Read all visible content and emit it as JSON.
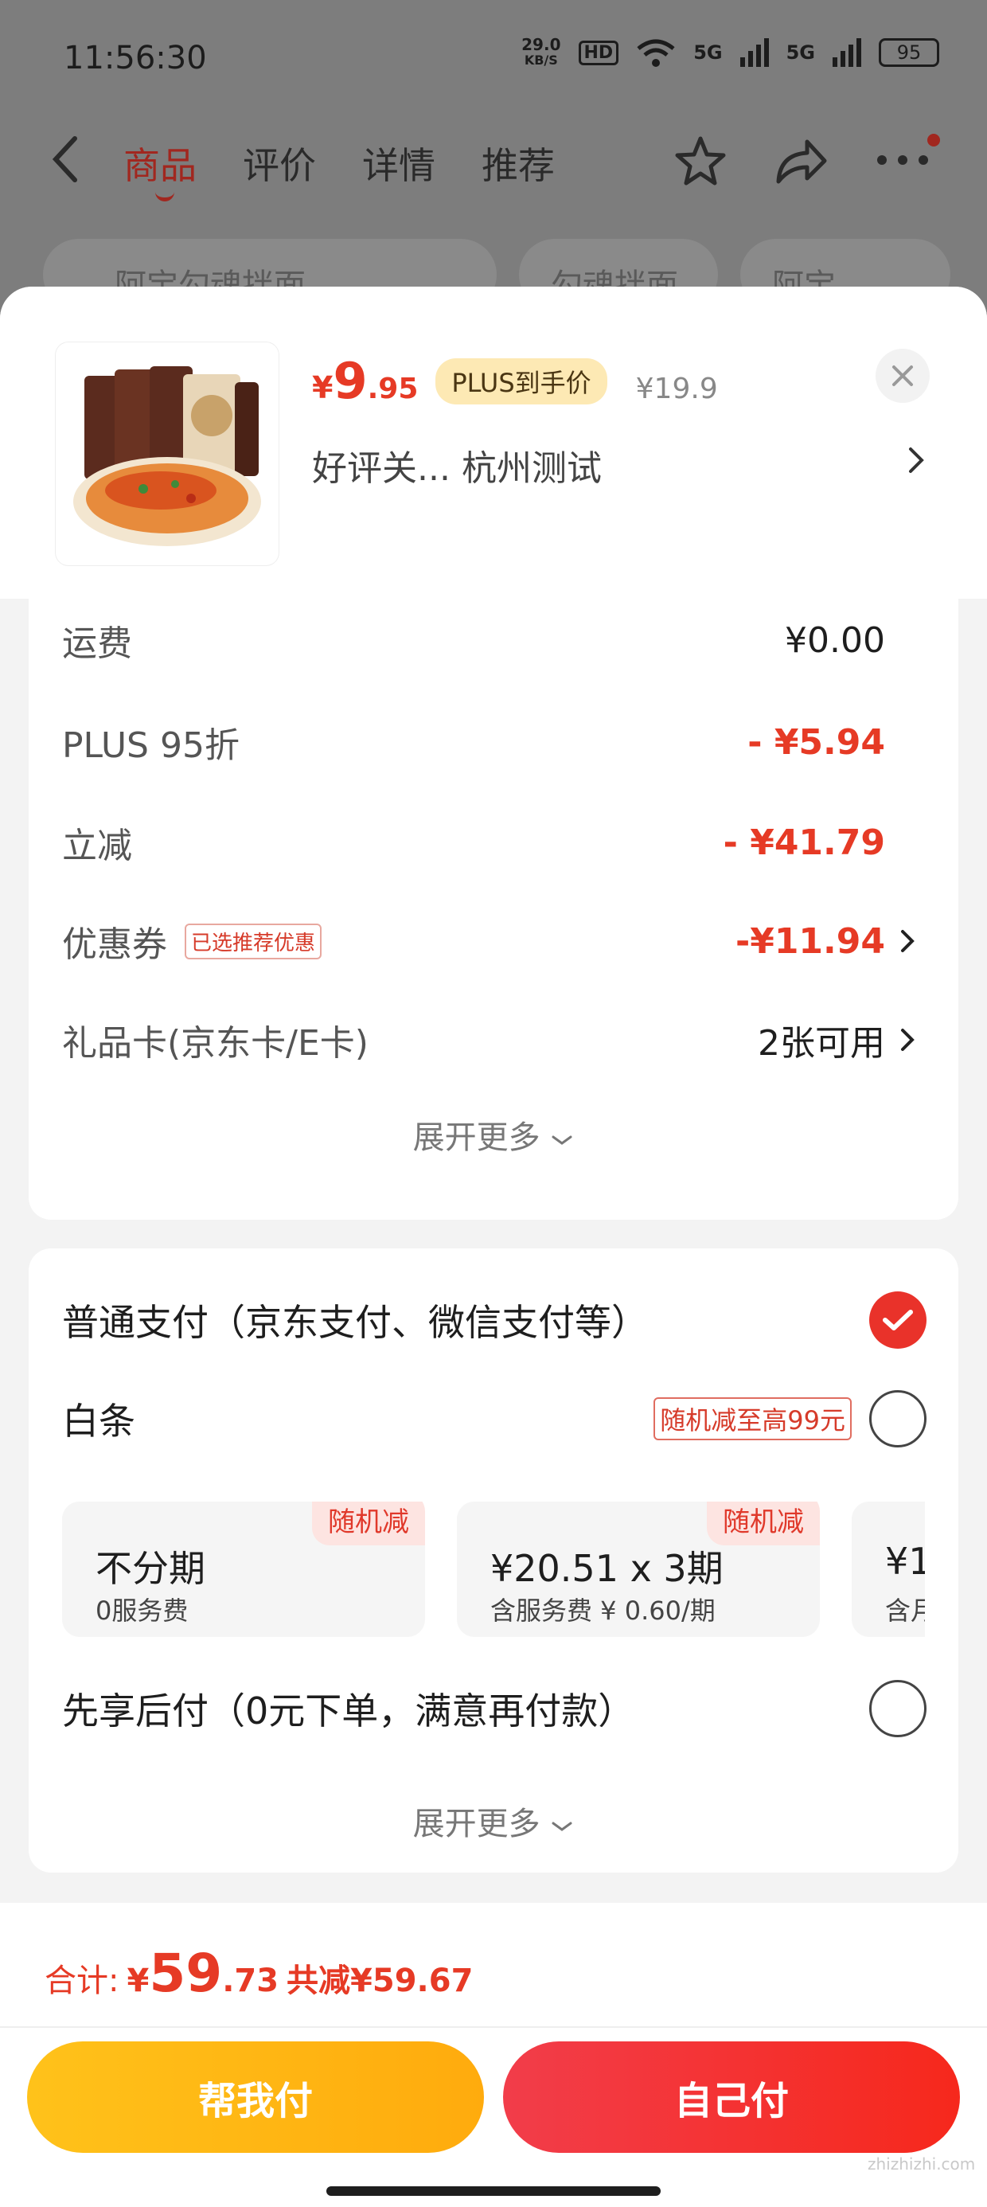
{
  "status_bar": {
    "time": "11:56:30",
    "speed_value": "29.0",
    "speed_unit": "KB/S",
    "hd": "HD",
    "sig1": "5G",
    "sig2": "5G",
    "battery": "95"
  },
  "nav": {
    "tabs": [
      "商品",
      "评价",
      "详情",
      "推荐"
    ]
  },
  "search_row": {
    "query": "阿宝勾魂拌面",
    "chip1": "勾魂拌面",
    "chip2": "阿宝"
  },
  "product": {
    "currency": "¥",
    "price_int": "9",
    "price_dec": ".95",
    "plus_badge": "PLUS到手价",
    "original_price": "¥19.9",
    "spec": "好评关...  杭州测试"
  },
  "costs": {
    "shipping_label": "运费",
    "shipping_value": "¥0.00",
    "plus_label": "PLUS 95折",
    "plus_value": "- ¥5.94",
    "instant_label": "立减",
    "instant_value": "- ¥41.79",
    "coupon_label": "优惠券",
    "coupon_tag": "已选推荐优惠",
    "coupon_value": "-¥11.94",
    "giftcard_label": "礼品卡(京东卡/E卡)",
    "giftcard_value": "2张可用",
    "expand": "展开更多"
  },
  "payment": {
    "normal_label": "普通支付（京东支付、微信支付等）",
    "baitiao_label": "白条",
    "baitiao_tag": "随机减至高99元",
    "plans": [
      {
        "badge": "随机减",
        "title": "不分期",
        "sub": "0服务费"
      },
      {
        "badge": "随机减",
        "title": "¥20.51 x 3期",
        "sub": "含服务费 ¥ 0.60/期"
      },
      {
        "badge": "",
        "title": "¥1",
        "sub": "含月"
      }
    ],
    "later_label": "先享后付（0元下单，满意再付款）",
    "expand": "展开更多"
  },
  "footer": {
    "total_label": "合计:",
    "total_sym": "¥",
    "total_int": "59",
    "total_dec": ".73",
    "saved": "共减¥59.67",
    "help_btn": "帮我付",
    "self_btn": "自己付",
    "watermark": "zhizhizhi.com"
  },
  "colors": {
    "accent": "#e63a25",
    "help_btn": "#ffb413",
    "self_btn": "#f23d4a"
  }
}
